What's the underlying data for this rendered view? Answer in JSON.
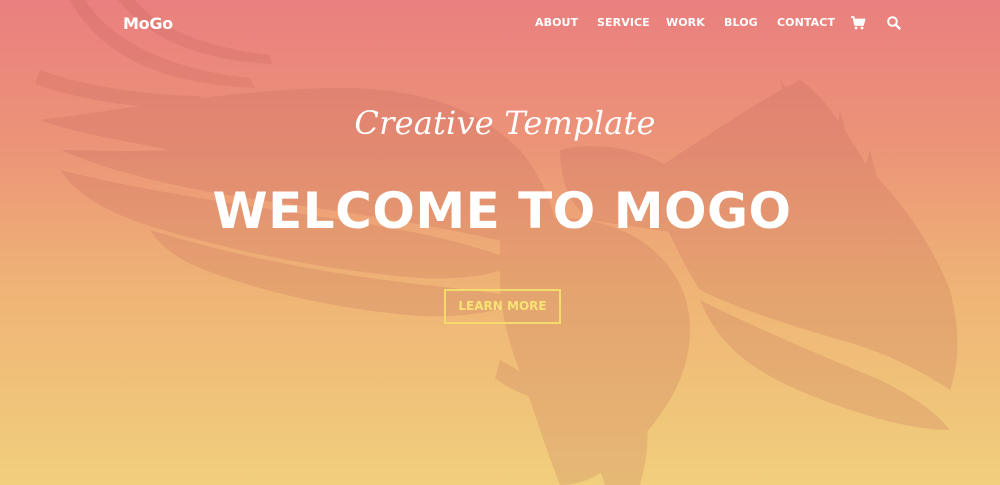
{
  "header": {
    "logo": "MoGo",
    "nav": [
      "ABOUT",
      "SERVICE",
      "WORK",
      "BLOG",
      "CONTACT"
    ],
    "icons": [
      "cart-icon",
      "search-icon"
    ]
  },
  "hero": {
    "subtitle": "Creative Template",
    "title": "WELCOME TO MOGO",
    "button_label": "LEARN MORE",
    "background_image": "eagle-icon"
  },
  "colors": {
    "gradient_top": "#ea7f7f",
    "gradient_bottom": "#f1cf7d",
    "text": "#ffffff",
    "button_border": "#f5db6b",
    "button_text": "#f7e276"
  }
}
